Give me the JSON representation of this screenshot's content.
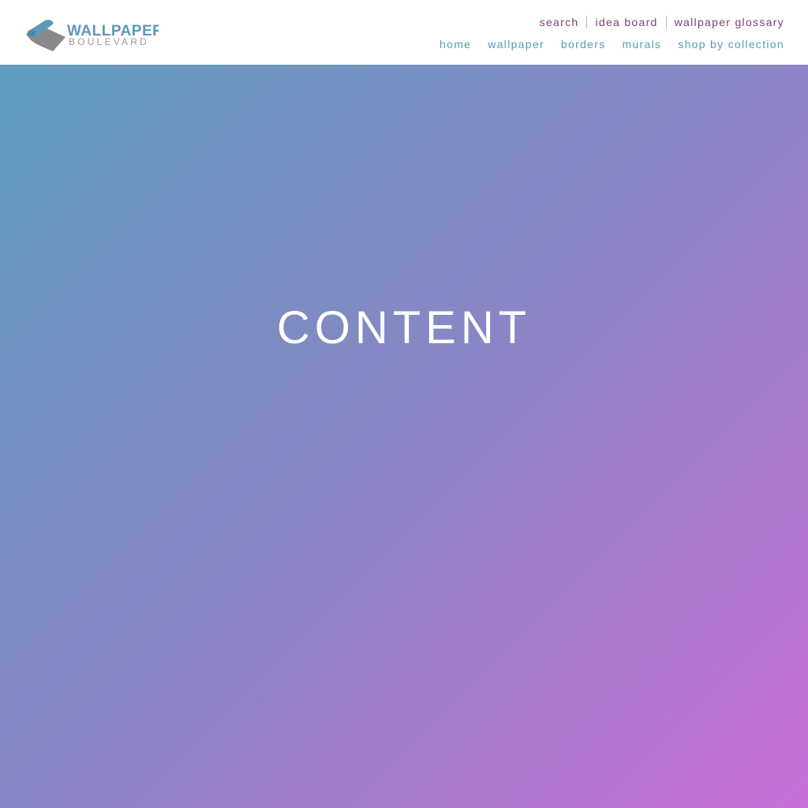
{
  "header": {
    "logo": {
      "line1": "WALLPAPER",
      "line2": "BOULEVARD",
      "icon": "wallpaper-roll-icon",
      "colors": {
        "roll_blue": "#5b9ab8",
        "roll_grey": "#8a8a8a",
        "text_blue": "#5b9ab8",
        "text_grey": "#9a9a9a"
      }
    },
    "utility_nav": {
      "search": "search",
      "idea_board": "idea board",
      "glossary": "wallpaper glossary",
      "color": "#7d3f6e"
    },
    "main_nav": {
      "items": [
        "home",
        "wallpaper",
        "borders",
        "murals",
        "shop by collection"
      ],
      "color": "#5b9ab8"
    }
  },
  "hero": {
    "title": "CONTENT",
    "gradient": {
      "start": "#5f9dbe",
      "mid": "#8a85c5",
      "end": "#c86ed8"
    }
  }
}
